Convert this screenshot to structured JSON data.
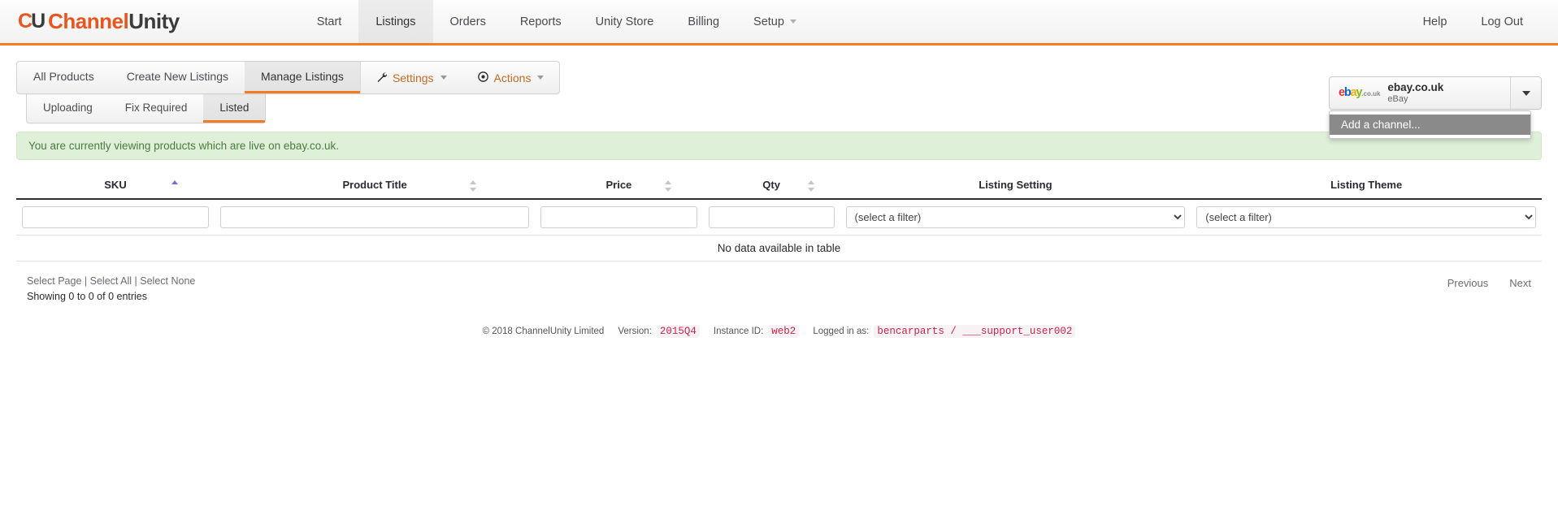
{
  "brand": {
    "mark_c": "C",
    "mark_u": "U",
    "name_part1": "Channel",
    "name_part2": "Unity",
    "accent": "#e8551f"
  },
  "topnav": {
    "items": [
      {
        "label": "Start",
        "active": false,
        "caret": false
      },
      {
        "label": "Listings",
        "active": true,
        "caret": false
      },
      {
        "label": "Orders",
        "active": false,
        "caret": false
      },
      {
        "label": "Reports",
        "active": false,
        "caret": false
      },
      {
        "label": "Unity Store",
        "active": false,
        "caret": false
      },
      {
        "label": "Billing",
        "active": false,
        "caret": false
      },
      {
        "label": "Setup",
        "active": false,
        "caret": true
      }
    ],
    "right": [
      {
        "label": "Help"
      },
      {
        "label": "Log Out"
      }
    ]
  },
  "tabs_primary": [
    {
      "label": "All Products",
      "active": false
    },
    {
      "label": "Create New Listings",
      "active": false
    },
    {
      "label": "Manage Listings",
      "active": true
    }
  ],
  "toolbar": [
    {
      "label": "Settings",
      "icon": "wrench-icon",
      "glyph": "🔧"
    },
    {
      "label": "Actions",
      "icon": "target-icon",
      "glyph": "⊙"
    }
  ],
  "tabs_secondary": [
    {
      "label": "Uploading",
      "active": false
    },
    {
      "label": "Fix Required",
      "active": false
    },
    {
      "label": "Listed",
      "active": true
    }
  ],
  "channel": {
    "logo_e": "e",
    "logo_b": "b",
    "logo_a": "a",
    "logo_y": "y",
    "logo_tld": ".co.uk",
    "title": "ebay.co.uk",
    "subtitle": "eBay",
    "menu_items": [
      {
        "label": "Add a channel...",
        "highlighted": true
      }
    ]
  },
  "alert": {
    "message": "You are currently viewing products which are live on ebay.co.uk.",
    "bg": "#dff0d8",
    "color": "#4b7a41"
  },
  "table": {
    "columns": [
      {
        "label": "SKU",
        "sortable": true,
        "sort": "asc",
        "filter_type": "text",
        "width": "13%"
      },
      {
        "label": "Product Title",
        "sortable": true,
        "sort": "none",
        "filter_type": "text",
        "width": "21%"
      },
      {
        "label": "Price",
        "sortable": true,
        "sort": "none",
        "filter_type": "text",
        "width": "11%"
      },
      {
        "label": "Qty",
        "sortable": true,
        "sort": "none",
        "filter_type": "text",
        "width": "9%"
      },
      {
        "label": "Listing Setting",
        "sortable": false,
        "sort": "none",
        "filter_type": "select",
        "width": "23%"
      },
      {
        "label": "Listing Theme",
        "sortable": false,
        "sort": "none",
        "filter_type": "select",
        "width": "23%"
      }
    ],
    "filter_values": [
      "",
      "",
      "",
      ""
    ],
    "filter_placeholders": [
      "",
      "",
      "",
      ""
    ],
    "select_value": "(select a filter)",
    "select_options": [
      "(select a filter)"
    ],
    "empty_message": "No data available in table",
    "rows": []
  },
  "table_footer": {
    "select_page": "Select Page",
    "separator1": " | ",
    "select_all": "Select All",
    "separator2": " | ",
    "select_none": "Select None",
    "showing": "Showing 0 to 0 of 0 entries",
    "previous": "Previous",
    "next": "Next"
  },
  "site_footer": {
    "copyright": "© 2018 ChannelUnity Limited",
    "version_label": "Version:",
    "version_value": "2015Q4",
    "instance_label": "Instance ID:",
    "instance_value": "web2",
    "logged_label": "Logged in as:",
    "logged_value": "bencarparts / ___support_user002"
  }
}
